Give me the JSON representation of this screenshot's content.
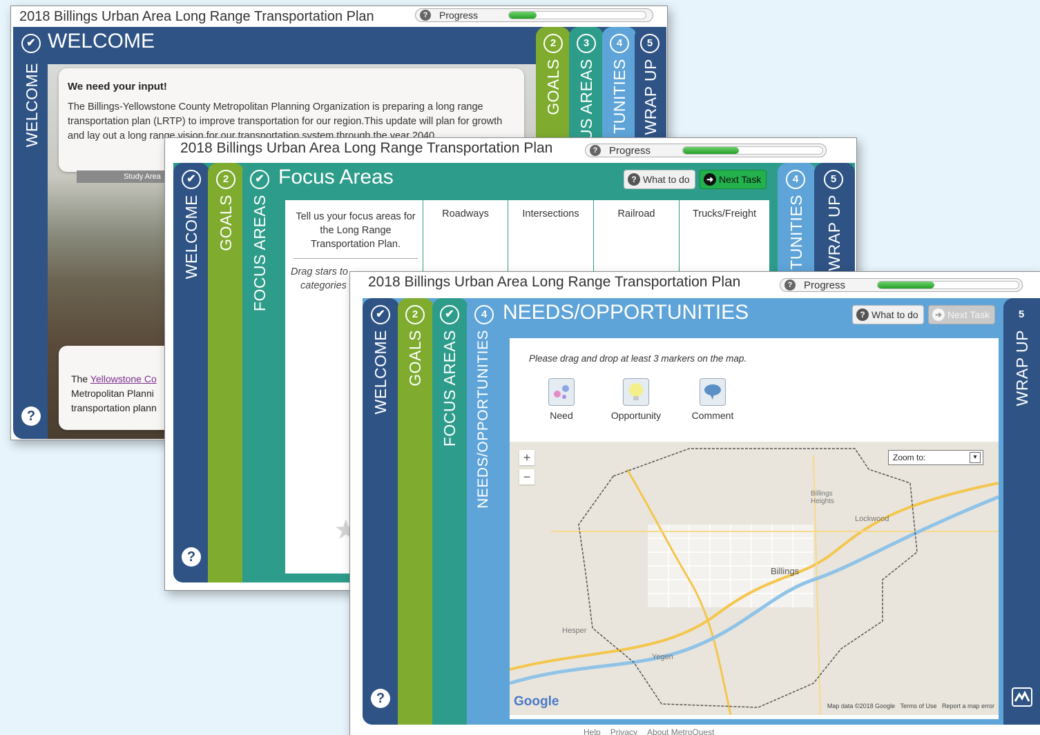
{
  "plan_title": "2018 Billings Urban Area Long Range Transportation Plan",
  "progress": {
    "label": "Progress",
    "help_glyph": "?"
  },
  "windows": {
    "welcome": {
      "progress_value": 0.2,
      "panel_title": "WELCOME",
      "left_tab": "WELCOME",
      "tabs": [
        {
          "num": "2",
          "label": "GOALS"
        },
        {
          "num": "3",
          "label": "US AREAS"
        },
        {
          "num": "4",
          "label": "TUNITIES"
        },
        {
          "num": "5",
          "label": "WRAP UP"
        }
      ],
      "card": {
        "heading": "We need your input!",
        "body": "The Billings-Yellowstone County Metropolitan Planning Organization is preparing a long range transportation plan (LRTP) to improve transportation for our region.This update will plan for growth and lay out a long range vision for our transportation system through the year 2040.",
        "map_tab": "Study Area"
      },
      "footer_note": {
        "line1_prefix": "The ",
        "line1_link": "Yellowstone Co",
        "line2": "Metropolitan Planni",
        "line3": "transportation plann"
      },
      "help": "?"
    },
    "focus": {
      "progress_value": 0.4,
      "panel_title": "Focus Areas",
      "tabs_left": [
        {
          "num": "✔",
          "label": "WELCOME"
        },
        {
          "num": "2",
          "label": "GOALS"
        },
        {
          "num": "✔",
          "label": "FOCUS AREAS"
        }
      ],
      "tabs_right": [
        {
          "num": "4",
          "label": "TUNITIES"
        },
        {
          "num": "5",
          "label": "WRAP UP"
        }
      ],
      "what_to_do": "What to do",
      "next_task": "Next Task",
      "intro": "Tell us your focus areas for the Long Range Transportation Plan.",
      "instructions": "Drag stars to",
      "instructions2": "categories",
      "columns": [
        "Roadways",
        "Intersections",
        "Railroad",
        "Trucks/Freight"
      ],
      "help": "?"
    },
    "needs": {
      "progress_value": 0.4,
      "panel_title": "NEEDS/OPPORTUNITIES",
      "tabs_left": [
        {
          "num": "✔",
          "label": "WELCOME"
        },
        {
          "num": "2",
          "label": "GOALS"
        },
        {
          "num": "✔",
          "label": "FOCUS AREAS"
        },
        {
          "num": "4",
          "label": "NEEDS/OPPORTUNITIES"
        }
      ],
      "tab_right": {
        "num": "5",
        "label": "WRAP UP"
      },
      "what_to_do": "What to do",
      "next_task": "Next Task",
      "instruction": "Please drag and drop at least 3 markers on the map.",
      "markers": [
        "Need",
        "Opportunity",
        "Comment"
      ],
      "map": {
        "zoom_to": "Zoom to:",
        "zoom_in": "+",
        "zoom_out": "−",
        "places": [
          "Billings Heights",
          "Lockwood",
          "Billings",
          "Yegen",
          "Hesper"
        ],
        "attribution": "Map data ©2018 Google   Terms of Use   Report a map error",
        "google": "Google"
      },
      "help": "?",
      "footer_links": [
        "Help",
        "Privacy",
        "About MetroQuest"
      ]
    }
  },
  "colors": {
    "navy": "#2e5384",
    "green": "#7fab2f",
    "teal": "#2e9c8a",
    "lightblue": "#5fa4d8",
    "next_green": "#22b14c"
  }
}
